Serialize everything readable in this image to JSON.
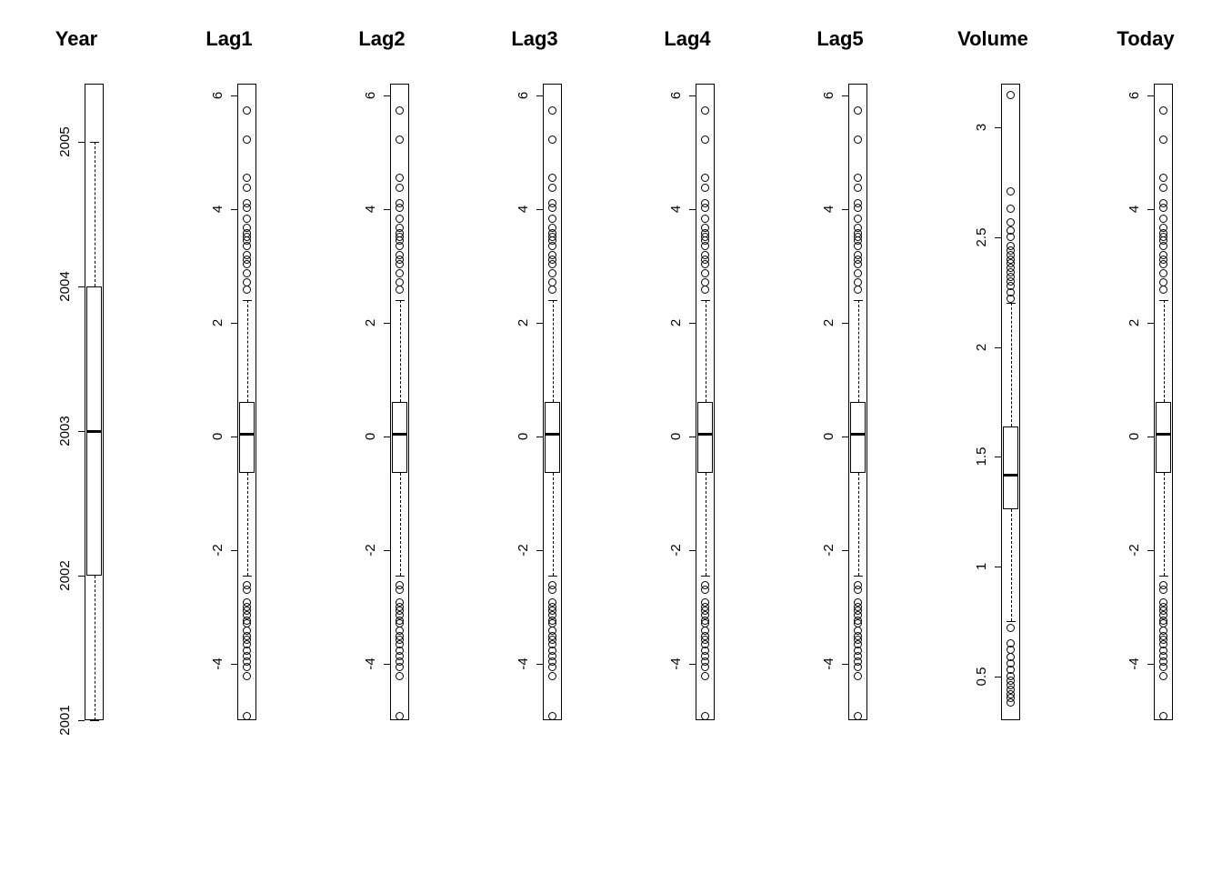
{
  "chart_data": [
    {
      "type": "boxplot",
      "title": "Year",
      "ylim": [
        2001,
        2005.4
      ],
      "ticks": [
        2001,
        2002,
        2003,
        2004,
        2005
      ],
      "box": {
        "q1": 2002,
        "median": 2003,
        "q3": 2004,
        "lower_whisker": 2001,
        "upper_whisker": 2005
      },
      "outliers": []
    },
    {
      "type": "boxplot",
      "title": "Lag1",
      "ylim": [
        -5.0,
        6.2
      ],
      "ticks": [
        -4,
        -2,
        0,
        2,
        4,
        6
      ],
      "box": {
        "q1": -0.64,
        "median": 0.04,
        "q3": 0.6,
        "lower_whisker": -2.45,
        "upper_whisker": 2.4
      },
      "outliers": [
        5.73,
        5.21,
        4.55,
        4.37,
        4.09,
        4.01,
        3.82,
        3.66,
        3.57,
        3.51,
        3.44,
        3.35,
        3.19,
        3.11,
        3.02,
        2.87,
        2.7,
        2.57,
        -2.62,
        -2.71,
        -2.92,
        -3.0,
        -3.07,
        -3.15,
        -3.24,
        -3.3,
        -3.42,
        -3.52,
        -3.59,
        -3.67,
        -3.77,
        -3.87,
        -3.96,
        -4.07,
        -4.22,
        -4.92
      ]
    },
    {
      "type": "boxplot",
      "title": "Lag2",
      "ylim": [
        -5.0,
        6.2
      ],
      "ticks": [
        -4,
        -2,
        0,
        2,
        4,
        6
      ],
      "box": {
        "q1": -0.64,
        "median": 0.04,
        "q3": 0.6,
        "lower_whisker": -2.45,
        "upper_whisker": 2.4
      },
      "outliers": [
        5.73,
        5.21,
        4.55,
        4.37,
        4.09,
        4.01,
        3.82,
        3.66,
        3.57,
        3.51,
        3.44,
        3.35,
        3.19,
        3.11,
        3.02,
        2.87,
        2.7,
        2.57,
        -2.62,
        -2.71,
        -2.92,
        -3.0,
        -3.07,
        -3.15,
        -3.24,
        -3.3,
        -3.42,
        -3.52,
        -3.59,
        -3.67,
        -3.77,
        -3.87,
        -3.96,
        -4.07,
        -4.22,
        -4.92
      ]
    },
    {
      "type": "boxplot",
      "title": "Lag3",
      "ylim": [
        -5.0,
        6.2
      ],
      "ticks": [
        -4,
        -2,
        0,
        2,
        4,
        6
      ],
      "box": {
        "q1": -0.64,
        "median": 0.04,
        "q3": 0.6,
        "lower_whisker": -2.45,
        "upper_whisker": 2.4
      },
      "outliers": [
        5.73,
        5.21,
        4.55,
        4.37,
        4.09,
        4.01,
        3.82,
        3.66,
        3.57,
        3.51,
        3.44,
        3.35,
        3.19,
        3.11,
        3.02,
        2.87,
        2.7,
        2.57,
        -2.62,
        -2.71,
        -2.92,
        -3.0,
        -3.07,
        -3.15,
        -3.24,
        -3.3,
        -3.42,
        -3.52,
        -3.59,
        -3.67,
        -3.77,
        -3.87,
        -3.96,
        -4.07,
        -4.22,
        -4.92
      ]
    },
    {
      "type": "boxplot",
      "title": "Lag4",
      "ylim": [
        -5.0,
        6.2
      ],
      "ticks": [
        -4,
        -2,
        0,
        2,
        4,
        6
      ],
      "box": {
        "q1": -0.64,
        "median": 0.04,
        "q3": 0.6,
        "lower_whisker": -2.45,
        "upper_whisker": 2.4
      },
      "outliers": [
        5.73,
        5.21,
        4.55,
        4.37,
        4.09,
        4.01,
        3.82,
        3.66,
        3.57,
        3.51,
        3.44,
        3.35,
        3.19,
        3.11,
        3.02,
        2.87,
        2.7,
        2.57,
        -2.62,
        -2.71,
        -2.92,
        -3.0,
        -3.07,
        -3.15,
        -3.24,
        -3.3,
        -3.42,
        -3.52,
        -3.59,
        -3.67,
        -3.77,
        -3.87,
        -3.96,
        -4.07,
        -4.22,
        -4.92
      ]
    },
    {
      "type": "boxplot",
      "title": "Lag5",
      "ylim": [
        -5.0,
        6.2
      ],
      "ticks": [
        -4,
        -2,
        0,
        2,
        4,
        6
      ],
      "box": {
        "q1": -0.64,
        "median": 0.04,
        "q3": 0.6,
        "lower_whisker": -2.45,
        "upper_whisker": 2.4
      },
      "outliers": [
        5.73,
        5.21,
        4.55,
        4.37,
        4.09,
        4.01,
        3.82,
        3.66,
        3.57,
        3.51,
        3.44,
        3.35,
        3.19,
        3.11,
        3.02,
        2.87,
        2.7,
        2.57,
        -2.62,
        -2.71,
        -2.92,
        -3.0,
        -3.07,
        -3.15,
        -3.24,
        -3.3,
        -3.42,
        -3.52,
        -3.59,
        -3.67,
        -3.77,
        -3.87,
        -3.96,
        -4.07,
        -4.22,
        -4.92
      ]
    },
    {
      "type": "boxplot",
      "title": "Volume",
      "ylim": [
        0.3,
        3.2
      ],
      "ticks": [
        0.5,
        1.0,
        1.5,
        2.0,
        2.5,
        3.0
      ],
      "box": {
        "q1": 1.26,
        "median": 1.42,
        "q3": 1.64,
        "lower_whisker": 0.75,
        "upper_whisker": 2.2
      },
      "outliers": [
        3.15,
        2.71,
        2.63,
        2.57,
        2.53,
        2.5,
        2.46,
        2.44,
        2.42,
        2.4,
        2.38,
        2.36,
        2.34,
        2.32,
        2.3,
        2.28,
        2.25,
        2.22,
        0.72,
        0.65,
        0.62,
        0.59,
        0.56,
        0.53,
        0.5,
        0.48,
        0.46,
        0.44,
        0.42,
        0.4,
        0.38
      ]
    },
    {
      "type": "boxplot",
      "title": "Today",
      "ylim": [
        -5.0,
        6.2
      ],
      "ticks": [
        -4,
        -2,
        0,
        2,
        4,
        6
      ],
      "box": {
        "q1": -0.64,
        "median": 0.04,
        "q3": 0.6,
        "lower_whisker": -2.45,
        "upper_whisker": 2.4
      },
      "outliers": [
        5.73,
        5.21,
        4.55,
        4.37,
        4.09,
        4.01,
        3.82,
        3.66,
        3.57,
        3.51,
        3.44,
        3.35,
        3.19,
        3.11,
        3.02,
        2.87,
        2.7,
        2.57,
        -2.62,
        -2.71,
        -2.92,
        -3.0,
        -3.07,
        -3.15,
        -3.24,
        -3.3,
        -3.42,
        -3.52,
        -3.59,
        -3.67,
        -3.77,
        -3.87,
        -3.96,
        -4.07,
        -4.22,
        -4.92
      ]
    }
  ]
}
